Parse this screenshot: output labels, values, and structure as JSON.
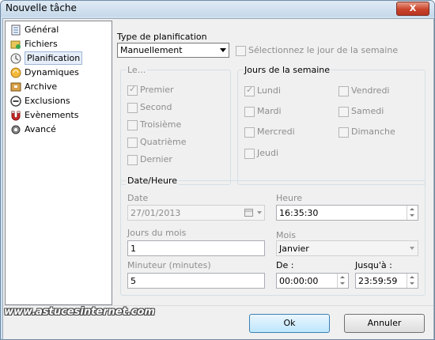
{
  "window": {
    "title": "Nouvelle tâche",
    "close_label": "X"
  },
  "sidebar": {
    "items": [
      {
        "label": "Général",
        "icon": "checklist-icon"
      },
      {
        "label": "Fichiers",
        "icon": "files-icon"
      },
      {
        "label": "Planification",
        "icon": "clock-icon",
        "selected": true
      },
      {
        "label": "Dynamiques",
        "icon": "sync-icon"
      },
      {
        "label": "Archive",
        "icon": "archive-icon"
      },
      {
        "label": "Exclusions",
        "icon": "exclusion-icon"
      },
      {
        "label": "Evènements",
        "icon": "magnet-icon"
      },
      {
        "label": "Avancé",
        "icon": "gear-icon"
      }
    ]
  },
  "planning": {
    "type_label": "Type de planification",
    "type_value": "Manuellement",
    "select_day_label": "Sélectionnez le jour de la semaine"
  },
  "le_group": {
    "title": "Le...",
    "options": [
      {
        "label": "Premier",
        "checked": true
      },
      {
        "label": "Second",
        "checked": false
      },
      {
        "label": "Troisième",
        "checked": false
      },
      {
        "label": "Quatrième",
        "checked": false
      },
      {
        "label": "Dernier",
        "checked": false
      }
    ]
  },
  "days_group": {
    "title": "Jours de la semaine",
    "days": [
      {
        "label": "Lundi",
        "checked": true
      },
      {
        "label": "Mardi",
        "checked": false
      },
      {
        "label": "Mercredi",
        "checked": false
      },
      {
        "label": "Jeudi",
        "checked": false
      },
      {
        "label": "Vendredi",
        "checked": false
      },
      {
        "label": "Samedi",
        "checked": false
      },
      {
        "label": "Dimanche",
        "checked": false
      }
    ]
  },
  "datetime": {
    "title": "Date/Heure",
    "date_label": "Date",
    "date_value": "27/01/2013",
    "time_label": "Heure",
    "time_value": "16:35:30",
    "days_of_month_label": "Jours du mois",
    "days_of_month_value": "1",
    "month_label": "Mois",
    "month_value": "Janvier",
    "timer_label": "Minuteur (minutes)",
    "timer_value": "5",
    "from_label": "De :",
    "from_value": "00:00:00",
    "to_label": "Jusqu'à :",
    "to_value": "23:59:59"
  },
  "buttons": {
    "ok": "Ok",
    "cancel": "Annuler"
  },
  "watermark": "www.astucesinternet.com",
  "colors": {
    "title_bar": "#c7d9ea",
    "close_button": "#c9432b",
    "primary_button": "#bee6fd"
  }
}
